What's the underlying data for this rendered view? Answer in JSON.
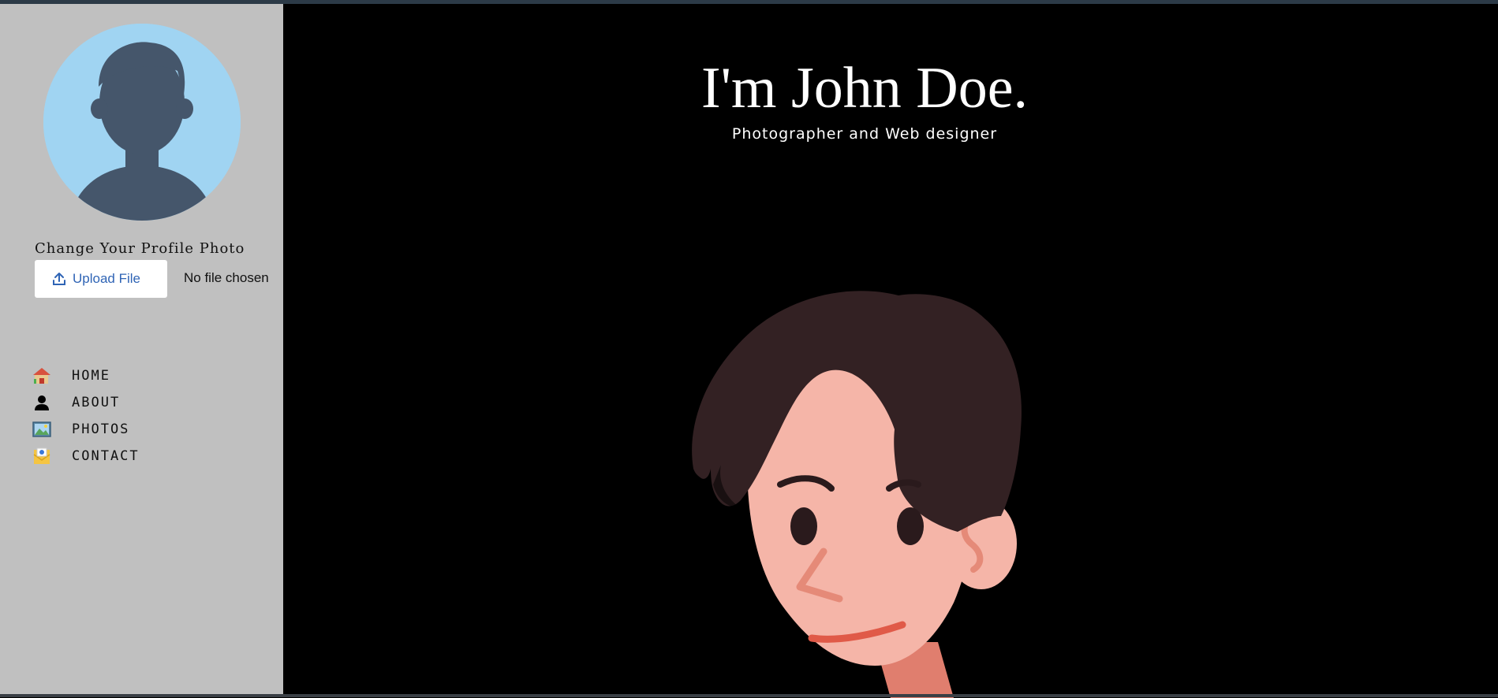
{
  "sidebar": {
    "change_photo_label": "Change Your Profile Photo",
    "upload_button_label": "Upload File",
    "file_status": "No file chosen",
    "nav": [
      {
        "label": "HOME",
        "icon": "house-icon"
      },
      {
        "label": "ABOUT",
        "icon": "person-icon"
      },
      {
        "label": "PHOTOS",
        "icon": "picture-icon"
      },
      {
        "label": "CONTACT",
        "icon": "envelope-icon"
      }
    ]
  },
  "hero": {
    "title": "I'm John Doe.",
    "subtitle": "Photographer and Web designer"
  },
  "colors": {
    "sidebar_bg": "#c0c0c0",
    "main_bg": "#000000",
    "avatar_bg": "#a0d4f2",
    "avatar_silhouette": "#45566b",
    "upload_text": "#2f64b5",
    "hair": "#332123",
    "skin": "#f5b5a8"
  }
}
